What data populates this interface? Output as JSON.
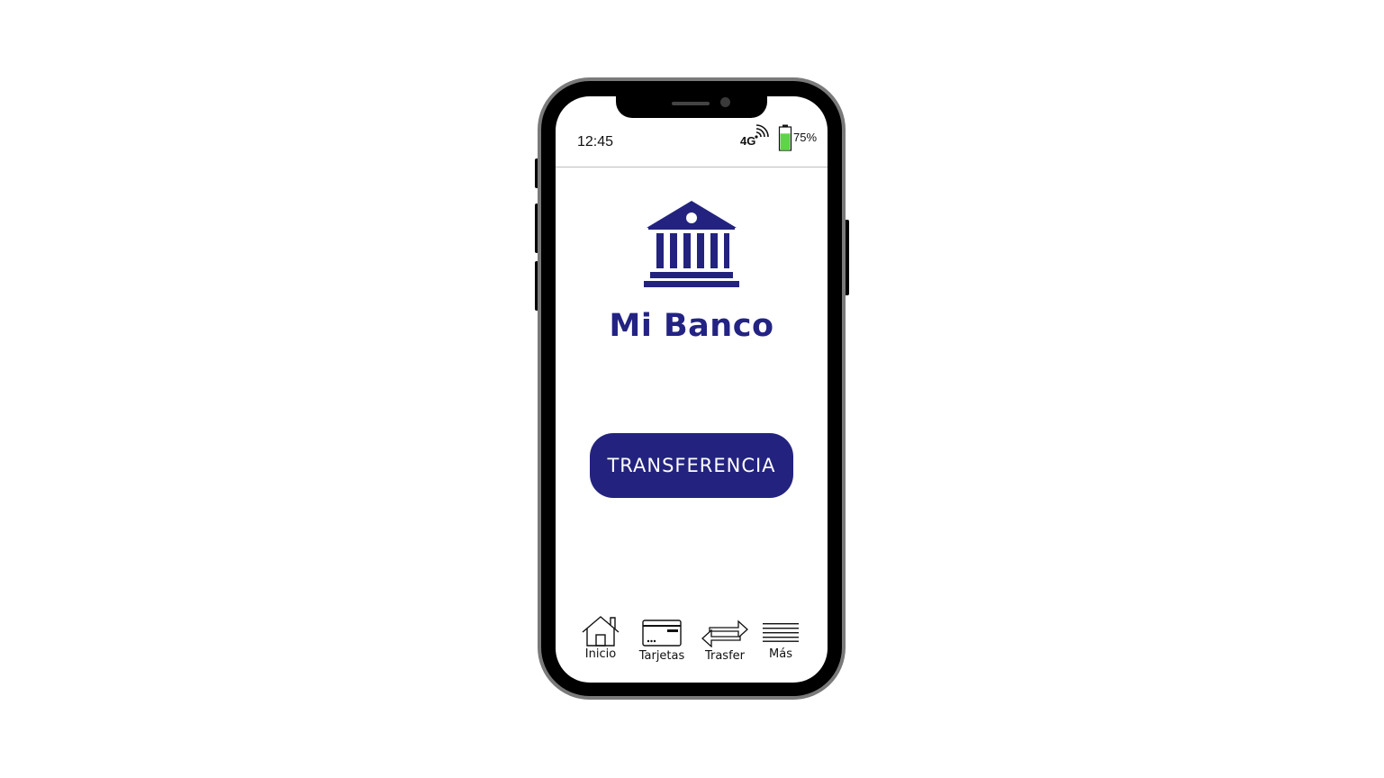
{
  "status_bar": {
    "time": "12:45",
    "network": "4G",
    "battery_percent": "75%",
    "battery_level": 0.75,
    "battery_color": "#5fd34a",
    "signal_icon": "signal-waves-icon"
  },
  "app": {
    "logo_icon": "bank-building-icon",
    "title": "Mi Banco",
    "brand_color": "#23237f"
  },
  "actions": {
    "transfer_label": "TRANSFERENCIA"
  },
  "bottom_nav": {
    "items": [
      {
        "label": "Inicio",
        "icon": "home-icon"
      },
      {
        "label": "Tarjetas",
        "icon": "card-icon"
      },
      {
        "label": "Trasfer",
        "icon": "transfer-arrows-icon"
      },
      {
        "label": "Más",
        "icon": "menu-lines-icon"
      }
    ]
  }
}
